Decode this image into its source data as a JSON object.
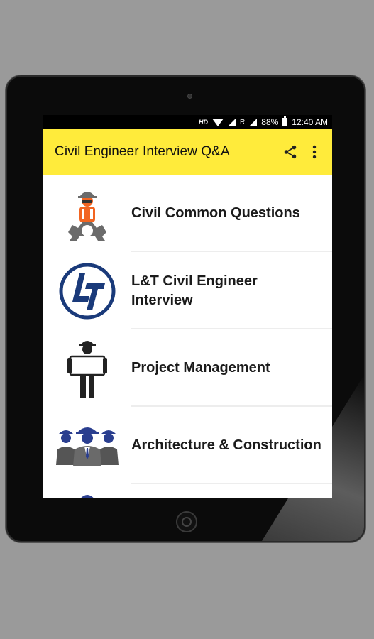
{
  "status_bar": {
    "hd": "HD",
    "roaming": "R",
    "battery": "88%",
    "time": "12:40 AM"
  },
  "app_bar": {
    "title": "Civil Engineer Interview Q&A",
    "share_icon": "share-icon",
    "menu_icon": "more-vert-icon",
    "background": "#ffeb3b"
  },
  "list": {
    "items": [
      {
        "label": "Civil Common Questions",
        "icon": "engineer-gear-icon"
      },
      {
        "label": "L&T Civil Engineer Interview",
        "icon": "lt-logo-icon"
      },
      {
        "label": "Project Management",
        "icon": "worker-blueprint-icon"
      },
      {
        "label": "Architecture & Construction",
        "icon": "engineers-group-icon"
      }
    ]
  }
}
